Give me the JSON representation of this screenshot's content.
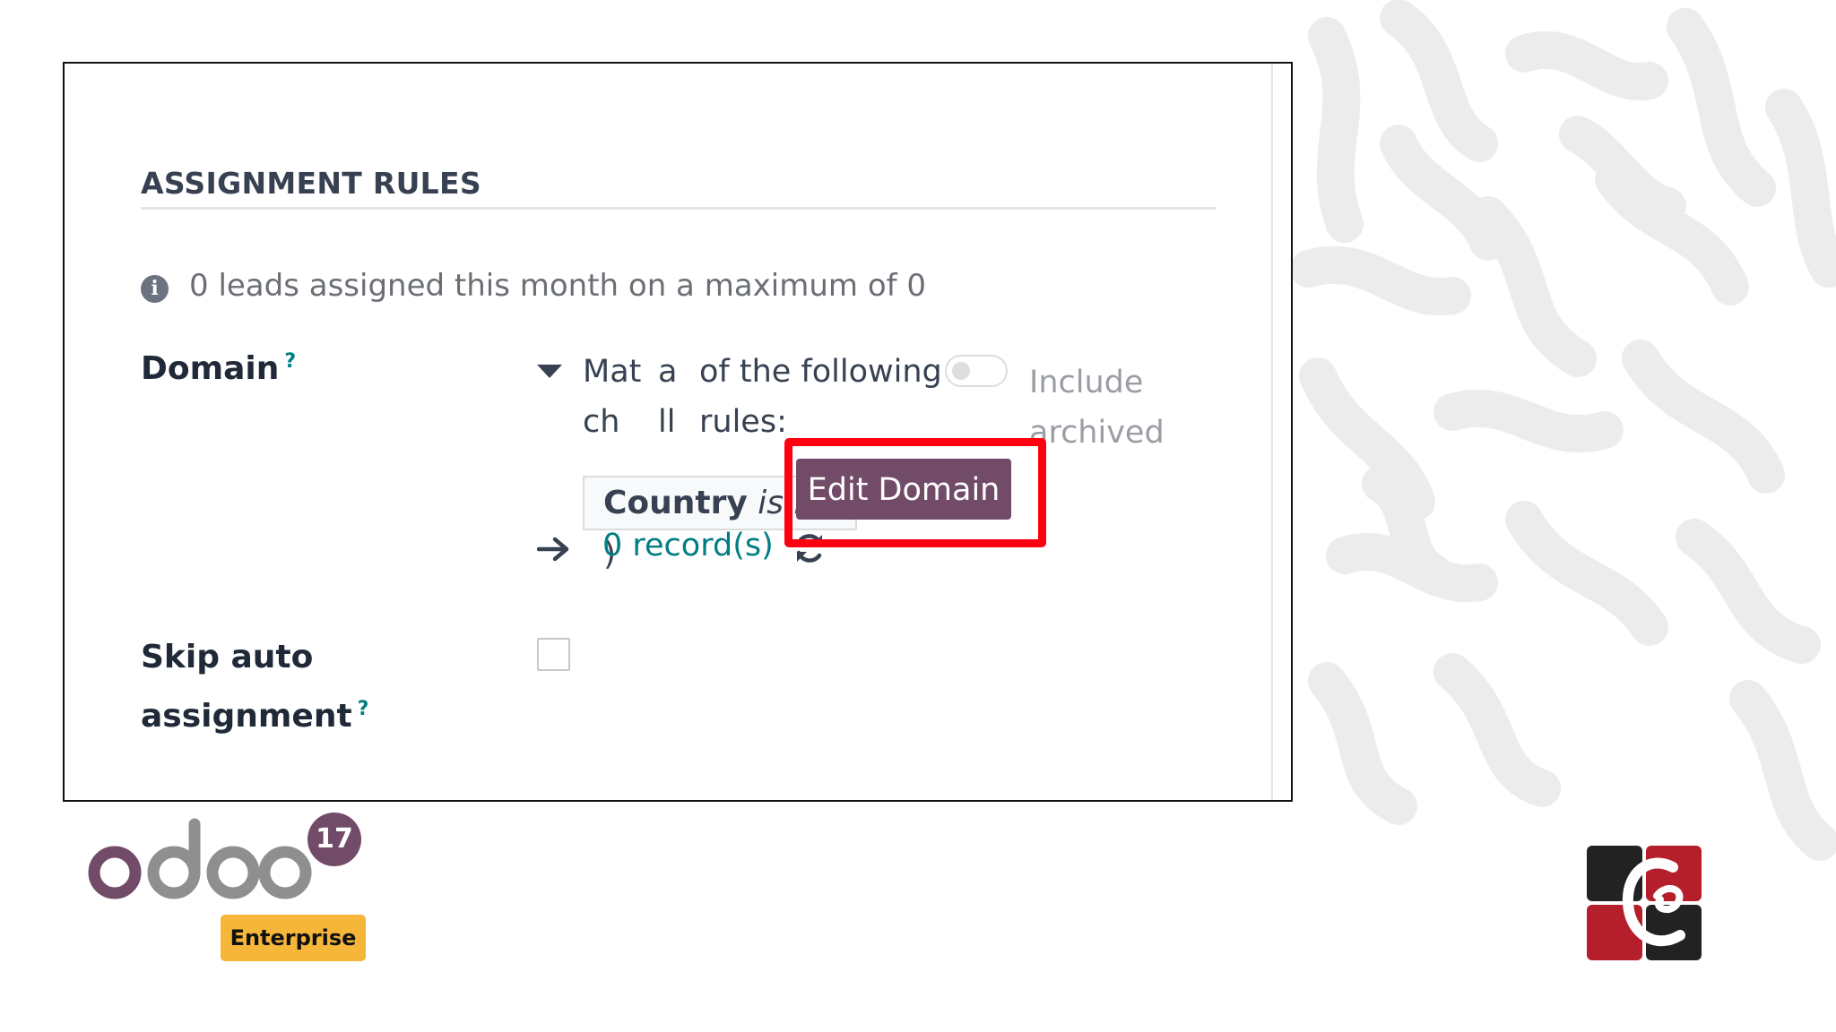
{
  "section": {
    "title": "ASSIGNMENT RULES"
  },
  "info": {
    "text": "0 leads assigned this month on a maximum of 0"
  },
  "domain": {
    "label": "Domain",
    "help": "?",
    "match_word_part1": "Mat",
    "match_word_part2": "ch",
    "all_word_part1": "a",
    "all_word_part2": "ll",
    "following_text": "of the following",
    "rules_text": "rules:",
    "include_archived_line1": "Include",
    "include_archived_line2": "archived",
    "include_archived_on": false,
    "rule": {
      "field": "Country",
      "operator": "is in",
      "value": "( )"
    },
    "records_label": "0 record(s)",
    "edit_button_label": "Edit Domain"
  },
  "skip_auto": {
    "label_line1": "Skip auto",
    "label_line2": "assignment",
    "help": "?",
    "checked": false
  },
  "branding": {
    "product": "odoo",
    "version": "17",
    "edition": "Enterprise"
  },
  "colors": {
    "primary": "#714b67",
    "link": "#017e84",
    "highlight": "#ff0010",
    "badge": "#f5b63a"
  },
  "icons": {
    "info": "info-circle-icon",
    "caret": "caret-down-icon",
    "arrow": "arrow-right-icon",
    "refresh": "refresh-icon"
  }
}
